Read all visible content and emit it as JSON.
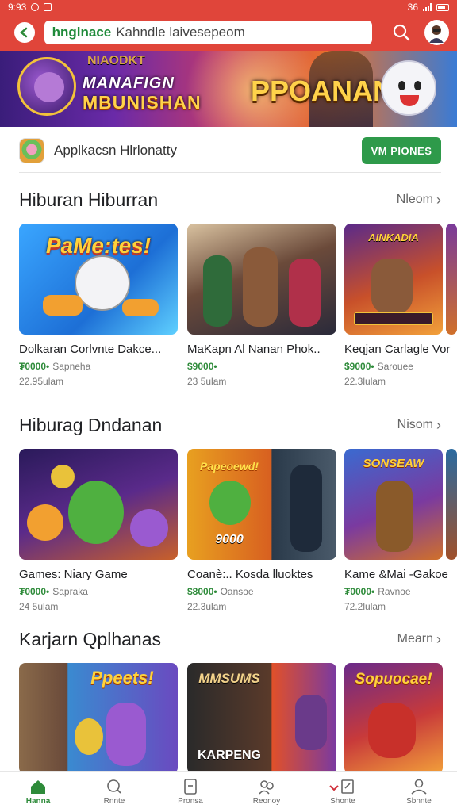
{
  "status_bar": {
    "time": "9:93",
    "signal_text": "36"
  },
  "header": {
    "search": {
      "brand": "hnglnace",
      "query": "Kahndle laivesepeom"
    }
  },
  "banner": {
    "top_text": "NIAODKT",
    "title_line1": "MANAFIGN",
    "title_line2": "MBUNISHAN",
    "right_text": "PPOANAN"
  },
  "featured_app": {
    "name": "Applkacsn Hlrlonatty",
    "button_label": "VM PIONES"
  },
  "sections": [
    {
      "title": "Hiburan Hiburran",
      "more_label": "Nleom",
      "cards": [
        {
          "title": "Dolkaran Corlvnte Dakce...",
          "price": "₮0000•",
          "note": "Sapneha",
          "meta": "22.95ulam",
          "thumb_text": "PaMe:tes!"
        },
        {
          "title": "MaKapn Al Nanan Phok..",
          "price": "$9000•",
          "note": "",
          "meta": "23 5ulam",
          "thumb_text": ""
        },
        {
          "title": "Keqjan Carlagle Vor",
          "price": "$9000•",
          "note": "Sarouee",
          "meta": "22.3lulam",
          "thumb_text": "AINKADIA"
        }
      ]
    },
    {
      "title": "Hiburag Dndanan",
      "more_label": "Nisom",
      "cards": [
        {
          "title": "Games: Niary Game",
          "price": "₮0000•",
          "note": "Sapraka",
          "meta": "24 5ulam",
          "thumb_text": ""
        },
        {
          "title": "Coanè:.. Kosda lluoktes",
          "price": "$8000•",
          "note": "Oansoe",
          "meta": "22.3ulam",
          "thumb_text": "Papeoewd!",
          "thumb_text2": "9000"
        },
        {
          "title": "Kame &Mai -Gakoe",
          "price": "₮0000•",
          "note": "Ravnoe",
          "meta": "72.2lulam",
          "thumb_text": "SONSEAW"
        }
      ]
    },
    {
      "title": "Karjarn Qplhanas",
      "more_label": "Mearn",
      "cards": [
        {
          "title": "",
          "price": "",
          "note": "",
          "meta": "",
          "thumb_text": "Ppeets!"
        },
        {
          "title": "",
          "price": "",
          "note": "",
          "meta": "",
          "thumb_text": "MMSUMS",
          "thumb_text2": "KARPENG"
        },
        {
          "title": "",
          "price": "",
          "note": "",
          "meta": "",
          "thumb_text": "Sopuocae!"
        }
      ]
    }
  ],
  "bottom_nav": [
    {
      "label": "Hanna",
      "icon": "home-icon",
      "active": true
    },
    {
      "label": "Rnnte",
      "icon": "search-icon",
      "active": false
    },
    {
      "label": "Pronsa",
      "icon": "document-icon",
      "active": false
    },
    {
      "label": "Reonoy",
      "icon": "people-icon",
      "active": false
    },
    {
      "label": "Shonte",
      "icon": "book-icon",
      "active": false
    },
    {
      "label": "Sbnnte",
      "icon": "person-icon",
      "active": false
    }
  ],
  "colors": {
    "brand_red": "#e0453a",
    "brand_green": "#2e9a4a",
    "price_green": "#2e8b3a"
  }
}
